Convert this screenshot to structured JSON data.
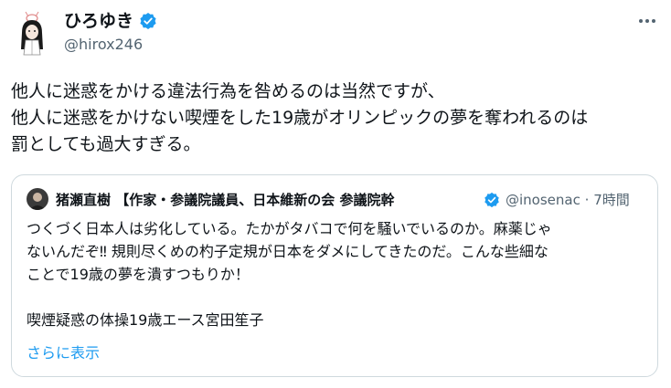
{
  "author": {
    "display_name": "ひろゆき",
    "handle": "@hirox246"
  },
  "tweet": {
    "lines": [
      "他人に迷惑をかける違法行為を咎めるのは当然ですが、",
      "他人に迷惑をかけない喫煙をした19歳がオリンピックの夢を奪われるのは",
      "罰としても過大すぎる。"
    ]
  },
  "quoted": {
    "display_name": "猪瀬直樹 【作家・参議院議員、日本維新の会 参議院幹",
    "handle": "@inosenac",
    "separator": "·",
    "time": "7時間",
    "lines": [
      "つくづく日本人は劣化している。たかがタバコで何を騒いでいるのか。麻薬じゃ",
      "ないんだぞ‼ 規則尽くめの杓子定規が日本をダメにしてきたのだ。こんな些細な",
      "ことで19歳の夢を潰すつもりか！",
      "",
      "喫煙疑惑の体操19歳エース宮田笙子"
    ],
    "show_more": "さらに表示"
  },
  "colors": {
    "text": "#0f1419",
    "secondary": "#536471",
    "link": "#1d9bf0",
    "verified": "#1d9bf0",
    "border": "#cfd9de"
  },
  "icons": {
    "verified": "verified-badge-icon",
    "more": "more-options-icon"
  }
}
